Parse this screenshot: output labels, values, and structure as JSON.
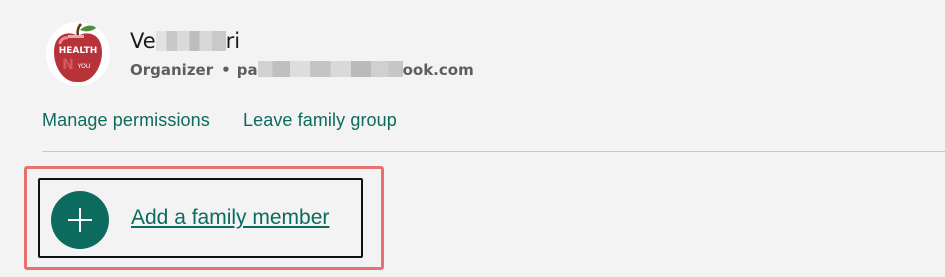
{
  "profile": {
    "name_start": "Ve",
    "name_end": "ri",
    "role": "Organizer",
    "separator": "•",
    "email_start": "pa",
    "email_end": "ook.com",
    "avatar": {
      "top_text": "HEALTH",
      "mid_text": "N",
      "small_text": "YOU"
    }
  },
  "actions": {
    "manage_permissions": "Manage permissions",
    "leave_group": "Leave family group"
  },
  "add_member": {
    "label": "Add a family member",
    "icon": "plus-icon"
  },
  "colors": {
    "accent": "#0c6a5e",
    "highlight": "#e8716f",
    "background": "#f3f3f3"
  }
}
